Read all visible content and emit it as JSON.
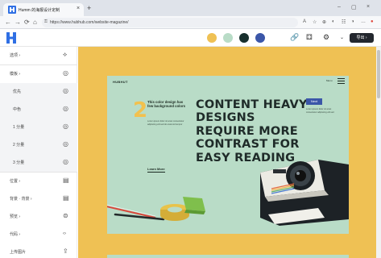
{
  "browser": {
    "tab_title": "Humm 的海报设计定制",
    "url": "https://www.hubhub.com/website-magazine/",
    "new_tab": "+",
    "close_tab": "×",
    "window_controls": [
      "–",
      "▢",
      "×"
    ],
    "nav": [
      "←",
      "→",
      "⟳",
      "⌂"
    ],
    "extension_icons": [
      "A",
      "☆",
      "⊕",
      "◐",
      "☷",
      "◑",
      "…"
    ]
  },
  "header": {
    "swatches": [
      "#efc154",
      "#b9dcc7",
      "#18302e",
      "#3b56a8"
    ],
    "tools": [
      "🔗",
      "⚃",
      "⚙",
      "⌄"
    ],
    "export_label": "导出 ›"
  },
  "sidebar": {
    "items": [
      {
        "label": "选项 ›",
        "icon": "⟡",
        "sub": false
      },
      {
        "label": "模板 ›",
        "icon": "◎",
        "sub": false
      },
      {
        "label": "优先",
        "icon": "◎",
        "sub": true
      },
      {
        "label": "中色",
        "icon": "◎",
        "sub": true
      },
      {
        "label": "1 分量",
        "icon": "◎",
        "sub": true
      },
      {
        "label": "2 分量",
        "icon": "◎",
        "sub": true
      },
      {
        "label": "3 分量",
        "icon": "◎",
        "sub": true
      },
      {
        "label": "位置 ›",
        "icon": "▤",
        "sub": false
      },
      {
        "label": "背景 · 背景 ›",
        "icon": "▤",
        "sub": false
      },
      {
        "label": "预览 ›",
        "icon": "⊜",
        "sub": false
      },
      {
        "label": "代码 ›",
        "icon": "‹›",
        "sub": false
      },
      {
        "label": "上传图片",
        "icon": "⇪",
        "sub": false
      }
    ]
  },
  "poster": {
    "brand": "HUBHUT",
    "nav_link": "Menu",
    "number": "2",
    "intro": "This color design has few background colors",
    "body": "Lorem ipsum dolor sit amet consectetur adipiscing elit sed do eiusmod tempor",
    "learn_more": "Learn More",
    "headline": "CONTENT HEAVY DESIGNS REQUIRE MORE CONTRAST FOR EASY READING",
    "next_label": "Next",
    "aside": "Lorem ipsum dolor sit amet consectetur adipiscing elit sed"
  }
}
